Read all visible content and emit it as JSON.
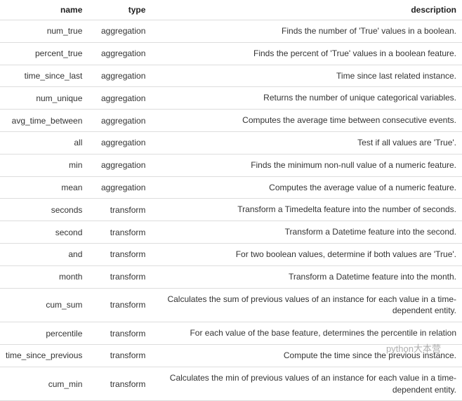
{
  "headers": {
    "name": "name",
    "type": "type",
    "description": "description"
  },
  "rows": [
    {
      "name": "num_true",
      "type": "aggregation",
      "description": "Finds the number of 'True' values in a boolean."
    },
    {
      "name": "percent_true",
      "type": "aggregation",
      "description": "Finds the percent of 'True' values in a boolean feature."
    },
    {
      "name": "time_since_last",
      "type": "aggregation",
      "description": "Time since last related instance."
    },
    {
      "name": "num_unique",
      "type": "aggregation",
      "description": "Returns the number of unique categorical variables."
    },
    {
      "name": "avg_time_between",
      "type": "aggregation",
      "description": "Computes the average time between consecutive events."
    },
    {
      "name": "all",
      "type": "aggregation",
      "description": "Test if all values are 'True'."
    },
    {
      "name": "min",
      "type": "aggregation",
      "description": "Finds the minimum non-null value of a numeric feature."
    },
    {
      "name": "mean",
      "type": "aggregation",
      "description": "Computes the average value of a numeric feature."
    },
    {
      "name": "seconds",
      "type": "transform",
      "description": "Transform a Timedelta feature into the number of seconds."
    },
    {
      "name": "second",
      "type": "transform",
      "description": "Transform a Datetime feature into the second."
    },
    {
      "name": "and",
      "type": "transform",
      "description": "For two boolean values, determine if both values are 'True'."
    },
    {
      "name": "month",
      "type": "transform",
      "description": "Transform a Datetime feature into the month."
    },
    {
      "name": "cum_sum",
      "type": "transform",
      "description": "Calculates the sum of previous values of an instance for each value in a time-dependent entity."
    },
    {
      "name": "percentile",
      "type": "transform",
      "description": "For each value of the base feature, determines the percentile in relation"
    },
    {
      "name": "time_since_previous",
      "type": "transform",
      "description": "Compute the time since the previous instance."
    },
    {
      "name": "cum_min",
      "type": "transform",
      "description": "Calculates the min of previous values of an instance for each value in a time-dependent entity."
    }
  ],
  "watermark": "python大本营"
}
